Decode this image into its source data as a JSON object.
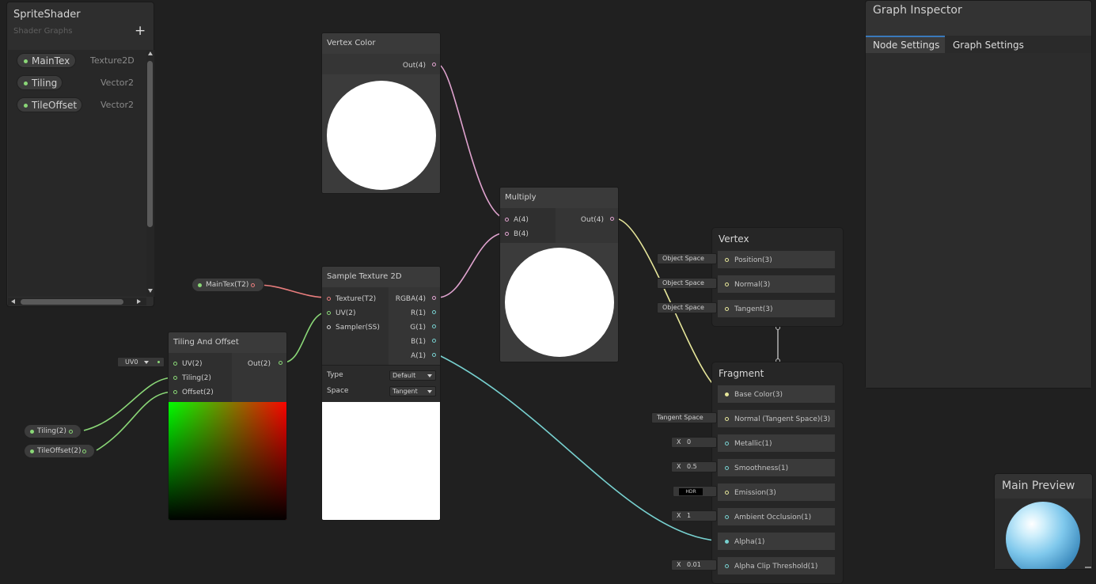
{
  "blackboard": {
    "title": "SpriteShader",
    "subtitle": "Shader Graphs",
    "add_icon": "+",
    "properties": [
      {
        "name": "MainTex",
        "type": "Texture2D"
      },
      {
        "name": "Tiling",
        "type": "Vector2"
      },
      {
        "name": "TileOffset",
        "type": "Vector2"
      }
    ]
  },
  "inspector": {
    "title": "Graph Inspector",
    "tabs": [
      "Node Settings",
      "Graph Settings"
    ]
  },
  "preview": {
    "title": "Main Preview"
  },
  "nodes": {
    "vertex_color": {
      "title": "Vertex Color",
      "out": "Out(4)"
    },
    "multiply": {
      "title": "Multiply",
      "in_a": "A(4)",
      "in_b": "B(4)",
      "out": "Out(4)"
    },
    "sample_texture": {
      "title": "Sample Texture 2D",
      "inputs": [
        "Texture(T2)",
        "UV(2)",
        "Sampler(SS)"
      ],
      "outputs": [
        "RGBA(4)",
        "R(1)",
        "G(1)",
        "B(1)",
        "A(1)"
      ],
      "type_label": "Type",
      "type_value": "Default",
      "space_label": "Space",
      "space_value": "Tangent"
    },
    "tiling_offset": {
      "title": "Tiling And Offset",
      "inputs": [
        "UV(2)",
        "Tiling(2)",
        "Offset(2)"
      ],
      "out": "Out(2)",
      "uv_value": "UV0"
    },
    "maintex_prop": "MainTex(T2)",
    "tiling_prop": "Tiling(2)",
    "tileoffset_prop": "TileOffset(2)"
  },
  "master_vertex": {
    "title": "Vertex",
    "slots": [
      {
        "value": "Object Space",
        "label": "Position(3)"
      },
      {
        "value": "Object Space",
        "label": "Normal(3)"
      },
      {
        "value": "Object Space",
        "label": "Tangent(3)"
      }
    ]
  },
  "master_fragment": {
    "title": "Fragment",
    "slots": [
      {
        "label": "Base Color(3)"
      },
      {
        "value": "Tangent Space",
        "label": "Normal (Tangent Space)(3)"
      },
      {
        "x": "X",
        "value": "0",
        "label": "Metallic(1)"
      },
      {
        "x": "X",
        "value": "0.5",
        "label": "Smoothness(1)"
      },
      {
        "value": "HDR",
        "label": "Emission(3)"
      },
      {
        "x": "X",
        "value": "1",
        "label": "Ambient Occlusion(1)"
      },
      {
        "label": "Alpha(1)"
      },
      {
        "x": "X",
        "value": "0.01",
        "label": "Alpha Clip Threshold(1)"
      }
    ]
  },
  "colors": {
    "background": "#202020",
    "pink_wire": "#e0a3cf",
    "red_wire": "#e87d7d",
    "green_wire": "#8ad777",
    "yellow_wire": "#e6e69a",
    "cyan_wire": "#77d0cf",
    "accent_tab": "#3a79bb"
  }
}
